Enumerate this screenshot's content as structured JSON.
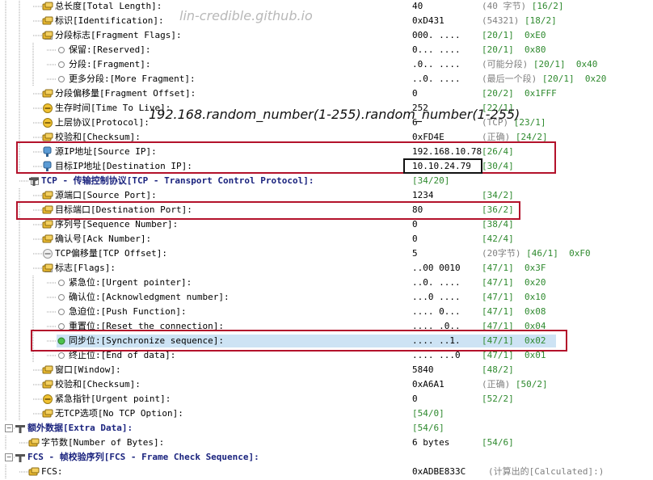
{
  "watermark": "lin-credible.github.io",
  "overlay_text": "192.168.random_number(1-255).random_number(1-255)",
  "rows": [
    {
      "indent": 2,
      "icon": "field",
      "label": "总长度[Total Length]:",
      "value": "40",
      "comment": "(40 字节)",
      "pos": "[16/2]",
      "hex": ""
    },
    {
      "indent": 2,
      "icon": "field",
      "label": "标识[Identification]:",
      "value": "0xD431",
      "comment": "(54321)",
      "pos": "[18/2]",
      "hex": ""
    },
    {
      "indent": 2,
      "icon": "flags",
      "toggle": "minus",
      "label": "分段标志[Fragment Flags]:",
      "value": "000. ....",
      "comment": "",
      "pos": "[20/1]",
      "hex": "0xE0"
    },
    {
      "indent": 3,
      "icon": "bit",
      "label": "保留:[Reserved]:",
      "value": "0... ....",
      "comment": "",
      "pos": "[20/1]",
      "hex": "0x80"
    },
    {
      "indent": 3,
      "icon": "bit",
      "label": "分段:[Fragment]:",
      "value": ".0.. ....",
      "comment": "(可能分段)",
      "pos": "[20/1]",
      "hex": "0x40"
    },
    {
      "indent": 3,
      "icon": "bit",
      "label": "更多分段:[More Fragment]:",
      "value": "..0. ....",
      "comment": "(最后一个段)",
      "pos": "[20/1]",
      "hex": "0x20"
    },
    {
      "indent": 2,
      "icon": "field",
      "label": "分段偏移量[Fragment Offset]:",
      "value": "0",
      "comment": "",
      "pos": "[20/2]",
      "hex": "0x1FFF"
    },
    {
      "indent": 2,
      "icon": "time",
      "label": "生存时间[Time To Live]:",
      "value": "252",
      "comment": "",
      "pos": "[22/1]",
      "hex": ""
    },
    {
      "indent": 2,
      "icon": "time",
      "label": "上层协议[Protocol]:",
      "value": "6",
      "comment": "(TCP)",
      "pos": "[23/1]",
      "hex": ""
    },
    {
      "indent": 2,
      "icon": "field",
      "label": "校验和[Checksum]:",
      "value": "0xFD4E",
      "comment": "(正确)",
      "pos": "[24/2]",
      "hex": ""
    },
    {
      "indent": 2,
      "icon": "ip",
      "label": "源IP地址[Source IP]:",
      "value": "192.168.10.78",
      "comment": "",
      "pos": "[26/4]",
      "hex": ""
    },
    {
      "indent": 2,
      "icon": "ip",
      "label": "目标IP地址[Destination IP]:",
      "value": "10.10.24.79",
      "comment": "",
      "pos": "[30/4]",
      "hex": ""
    },
    {
      "indent": 1,
      "icon": "proto",
      "toggle": "minus",
      "bold": true,
      "label": "TCP - 传输控制协议[TCP - Transport Control Protocol]:",
      "value": "",
      "comment": "",
      "pos": "[34/20]",
      "hex": "",
      "posLeft": 510
    },
    {
      "indent": 2,
      "icon": "field",
      "label": "源端口[Source Port]:",
      "value": "1234",
      "comment": "",
      "pos": "[34/2]",
      "hex": ""
    },
    {
      "indent": 2,
      "icon": "field",
      "label": "目标端口[Destination Port]:",
      "value": "80",
      "comment": "",
      "pos": "[36/2]",
      "hex": ""
    },
    {
      "indent": 2,
      "icon": "field",
      "label": "序列号[Sequence Number]:",
      "value": "0",
      "comment": "",
      "pos": "[38/4]",
      "hex": ""
    },
    {
      "indent": 2,
      "icon": "field",
      "label": "确认号[Ack Number]:",
      "value": "0",
      "comment": "",
      "pos": "[42/4]",
      "hex": ""
    },
    {
      "indent": 2,
      "icon": "offset",
      "label": "TCP偏移量[TCP Offset]:",
      "value": "5",
      "comment": "(20字节)",
      "pos": "[46/1]",
      "hex": "0xF0"
    },
    {
      "indent": 2,
      "icon": "flags",
      "toggle": "minus",
      "label": "标志[Flags]:",
      "value": "..00 0010",
      "comment": "",
      "pos": "[47/1]",
      "hex": "0x3F"
    },
    {
      "indent": 3,
      "icon": "bit",
      "label": "紧急位:[Urgent pointer]:",
      "value": "..0. ....",
      "comment": "",
      "pos": "[47/1]",
      "hex": "0x20"
    },
    {
      "indent": 3,
      "icon": "bit",
      "label": "确认位:[Acknowledgment number]:",
      "value": "...0 ....",
      "comment": "",
      "pos": "[47/1]",
      "hex": "0x10"
    },
    {
      "indent": 3,
      "icon": "bit",
      "label": "急迫位:[Push Function]:",
      "value": ".... 0...",
      "comment": "",
      "pos": "[47/1]",
      "hex": "0x08"
    },
    {
      "indent": 3,
      "icon": "bit",
      "label": "重置位:[Reset the connection]:",
      "value": ".... .0..",
      "comment": "",
      "pos": "[47/1]",
      "hex": "0x04"
    },
    {
      "indent": 3,
      "icon": "bit-on",
      "selected": true,
      "label": "同步位:[Synchronize sequence]:",
      "value": ".... ..1.",
      "comment": "",
      "pos": "[47/1]",
      "hex": "0x02"
    },
    {
      "indent": 3,
      "icon": "bit",
      "label": "终止位:[End of data]:",
      "value": ".... ...0",
      "comment": "",
      "pos": "[47/1]",
      "hex": "0x01"
    },
    {
      "indent": 2,
      "icon": "field",
      "label": "窗口[Window]:",
      "value": "5840",
      "comment": "",
      "pos": "[48/2]",
      "hex": ""
    },
    {
      "indent": 2,
      "icon": "field",
      "label": "校验和[Checksum]:",
      "value": "0xA6A1",
      "comment": "(正确)",
      "pos": "[50/2]",
      "hex": ""
    },
    {
      "indent": 2,
      "icon": "time",
      "label": "紧急指针[Urgent point]:",
      "value": "0",
      "comment": "",
      "pos": "[52/2]",
      "hex": ""
    },
    {
      "indent": 2,
      "icon": "field",
      "label": "无TCP选项[No TCP Option]:",
      "value": "",
      "comment": "",
      "pos": "[54/0]",
      "hex": "",
      "posLeft": 510
    },
    {
      "indent": 0,
      "icon": "proto",
      "toggle": "minus",
      "bold": true,
      "label": "额外数据[Extra Data]:",
      "value": "",
      "comment": "",
      "pos": "[54/6]",
      "hex": "",
      "posLeft": 510
    },
    {
      "indent": 1,
      "icon": "field",
      "label": "字节数[Number of Bytes]:",
      "value": "6 bytes",
      "comment": "",
      "pos": "[54/6]",
      "hex": ""
    },
    {
      "indent": 0,
      "icon": "proto",
      "toggle": "minus",
      "bold": true,
      "label": "FCS - 帧校验序列[FCS - Frame Check Sequence]:",
      "value": "",
      "comment": "",
      "pos": "",
      "hex": ""
    },
    {
      "indent": 1,
      "icon": "field",
      "label": "FCS:",
      "value": "0xADBE833C",
      "comment": "(计算出的[Calculated]:)",
      "pos": "",
      "hex": ""
    }
  ]
}
